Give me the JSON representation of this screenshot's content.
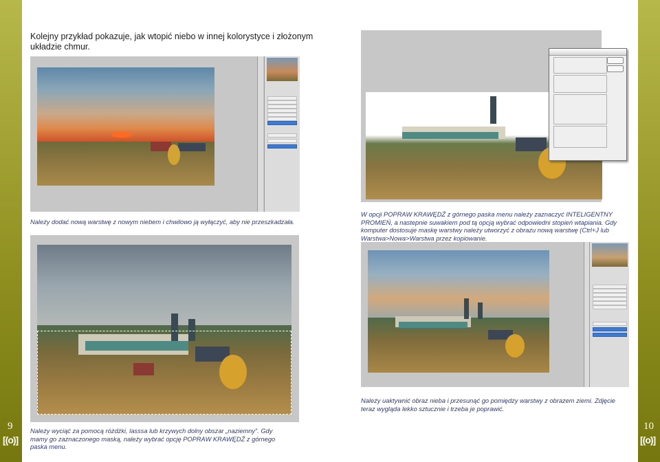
{
  "page_numbers": {
    "left": "9",
    "right": "10"
  },
  "logo": {
    "text": "[(o)]"
  },
  "left_page": {
    "heading": "Kolejny przykład pokazuje, jak wtopić niebo w innej kolorystyce i złożonym układzie chmur.",
    "caption_top": "Należy dodać nową warstwę z nowym niebem i chwilowo ją wyłączyć, aby nie przeszkadzała.",
    "caption_bottom": "Należy wyciąć za pomocą różdżki, lasssa lub krzywych dolny obszar „naziemny”. Gdy mamy go zaznaczonego maską, należy wybrać opcję POPRAW KRAWĘDŹ z górnego paska menu."
  },
  "right_page": {
    "caption_top": "W opcji POPRAW KRAWĘDŹ z górnego paska menu należy zaznaczyć INTELIGENTNY PROMIEŃ, a nastepnie suwakiem pod tą opcją wybrać odpowiedni stopień wtapiania. Gdy komputer dostosuje maskę warstwy należy utworzyć z obrazu nową warstwę (Ctrl+J lub Warstwa>Nowa>Warstwa przez kopiowanie.",
    "caption_bottom": "Należy uaktywnić obraz nieba i przesunąć go pomiędzy warstwy z obrazem ziemi. Zdjęcie teraz wygląda lekko sztucznie i trzeba je poprawić."
  },
  "colors": {
    "side_bar": "#8e8f1f",
    "caption_text": "#2d3a78",
    "panel_gray": "#c7c7c7",
    "selected_layer": "#3d7bd6"
  }
}
